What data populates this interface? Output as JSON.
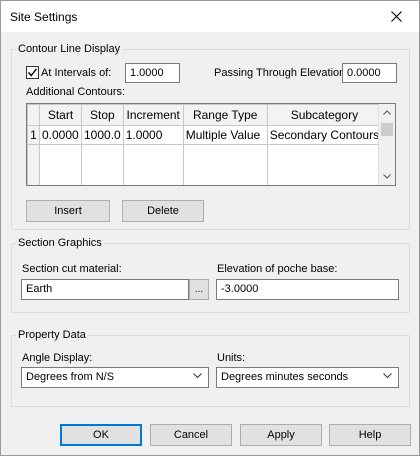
{
  "dialog": {
    "title": "Site Settings"
  },
  "contour": {
    "group_label": "Contour Line Display",
    "at_intervals_label": "At Intervals of:",
    "at_intervals_checked": true,
    "at_intervals_value": "1.0000",
    "passing_label": "Passing Through Elevation:",
    "passing_value": "0.0000",
    "additional_label": "Additional Contours:",
    "columns": [
      "Start",
      "Stop",
      "Increment",
      "Range Type",
      "Subcategory"
    ],
    "rows": [
      {
        "index": "1",
        "start": "0.0000",
        "stop": "1000.0",
        "increment": "1.0000",
        "range_type": "Multiple Value",
        "subcategory": "Secondary Contours"
      }
    ],
    "insert_label": "Insert",
    "delete_label": "Delete"
  },
  "section": {
    "group_label": "Section Graphics",
    "cut_label": "Section cut material:",
    "cut_value": "Earth",
    "browse_label": "...",
    "poche_label": "Elevation of poche base:",
    "poche_value": "-3.0000"
  },
  "property": {
    "group_label": "Property Data",
    "angle_label": "Angle Display:",
    "angle_value": "Degrees from N/S",
    "units_label": "Units:",
    "units_value": "Degrees minutes seconds"
  },
  "buttons": {
    "ok": "OK",
    "cancel": "Cancel",
    "apply": "Apply",
    "help": "Help"
  },
  "icons": {
    "close": "close-icon",
    "check": "check-icon",
    "chevron": "chevron-down-icon"
  }
}
